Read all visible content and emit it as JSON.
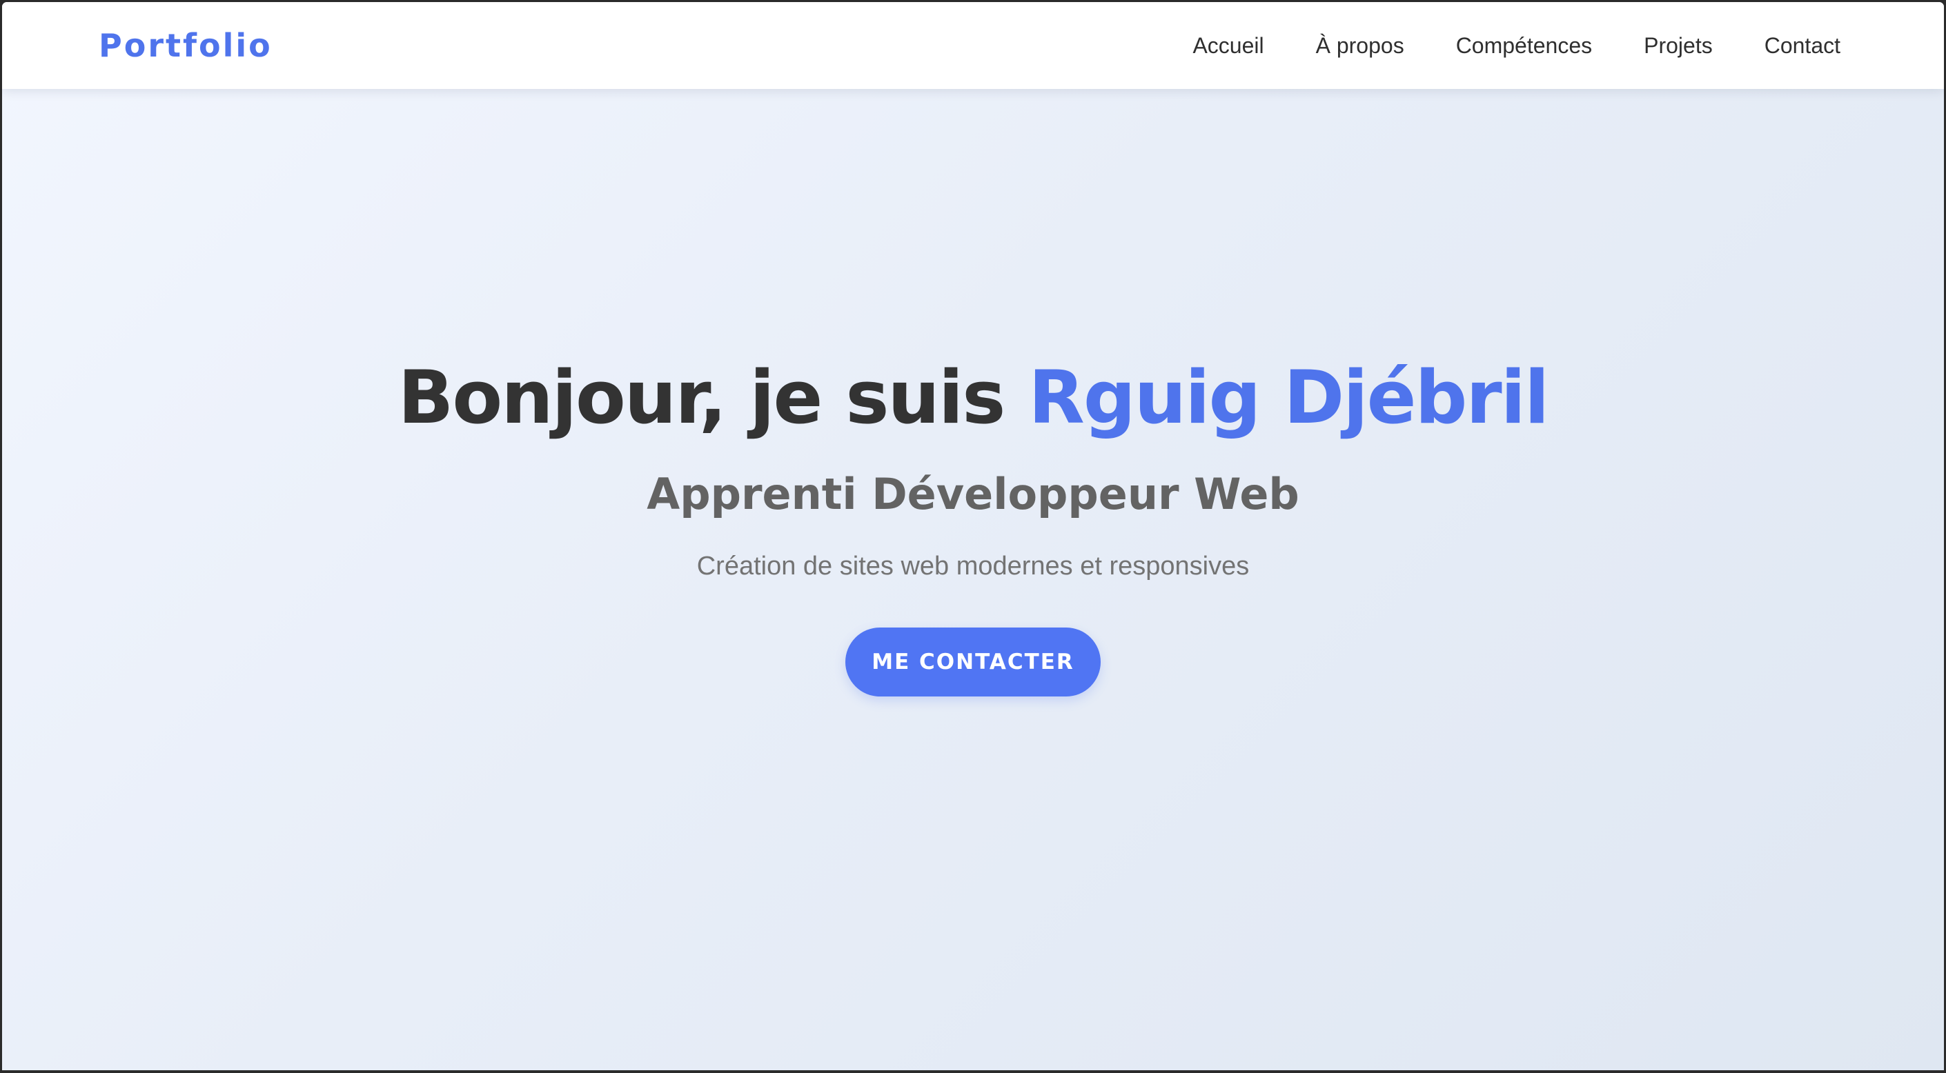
{
  "navbar": {
    "brand": "Portfolio",
    "links": [
      {
        "label": "Accueil"
      },
      {
        "label": "À propos"
      },
      {
        "label": "Compétences"
      },
      {
        "label": "Projets"
      },
      {
        "label": "Contact"
      }
    ]
  },
  "hero": {
    "greeting": "Bonjour, je suis ",
    "name": "Rguig Djébril",
    "subtitle": "Apprenti Développeur Web",
    "tagline": "Création de sites web modernes et responsives",
    "cta_label": "ME CONTACTER"
  },
  "colors": {
    "accent": "#4f74ec",
    "button": "#5075f3",
    "heading": "#333333",
    "subtitle": "#636363",
    "tagline": "#737373",
    "background_start": "#f2f6fe",
    "background_end": "#dfe7f2"
  }
}
